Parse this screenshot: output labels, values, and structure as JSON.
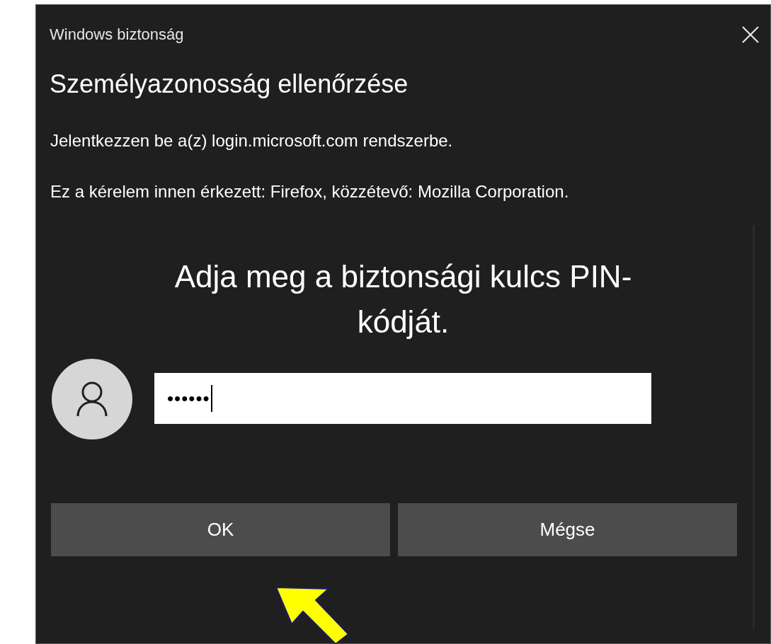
{
  "window": {
    "title": "Windows biztonság"
  },
  "heading": "Személyazonosság ellenőrzése",
  "messages": [
    "Jelentkezzen be a(z) login.microsoft.com rendszerbe.",
    "Ez a kérelem innen érkezett: Firefox, közzétevő: Mozilla Corporation."
  ],
  "prompt": "Adja meg a biztonsági kulcs PIN-kódját.",
  "pin_field": {
    "value": "••••••"
  },
  "buttons": [
    {
      "label": "OK"
    },
    {
      "label": "Mégse"
    }
  ]
}
